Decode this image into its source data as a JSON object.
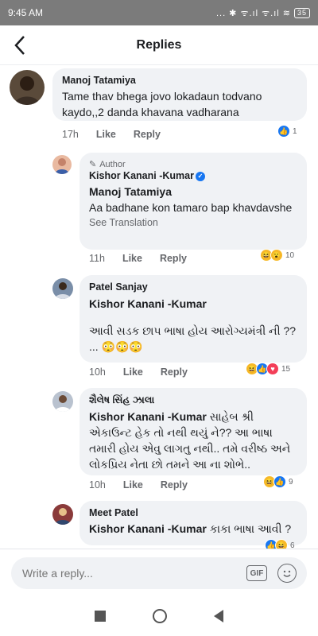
{
  "status_bar": {
    "time": "9:45 AM",
    "indicators": "... ✱ ᯤ.ıl ᯤ.ıl ≋",
    "battery": "35"
  },
  "header": {
    "title": "Replies",
    "back_icon": "back-arrow-icon"
  },
  "comments": [
    {
      "author": "Manoj Tatamiya",
      "text": "Tame thav bhega jovo lokadaun todvano kaydo,,2  danda khavana vadharana",
      "time": "17h",
      "like": "Like",
      "reply": "Reply",
      "reactions": [
        "like"
      ],
      "reaction_count": "1"
    },
    {
      "author_badge": "Author",
      "author": "Kishor Kanani -Kumar",
      "mention": "Manoj Tatamiya",
      "text": "Aa badhane kon tamaro bap khavdavshe",
      "see_translation": "See Translation",
      "time": "11h",
      "like": "Like",
      "reply": "Reply",
      "reactions": [
        "haha",
        "wow"
      ],
      "reaction_count": "10"
    },
    {
      "author": "Patel Sanjay",
      "mention": "Kishor Kanani -Kumar",
      "text": "આવી સડક છાપ ભાષા હોય આરોગ્યમંત્રી ની ?? ... 😳😳😳",
      "time": "10h",
      "like": "Like",
      "reply": "Reply",
      "reactions": [
        "haha",
        "like",
        "love"
      ],
      "reaction_count": "15"
    },
    {
      "author": "શૈલેષ સિંહ ઝાલા",
      "mention": "Kishor Kanani -Kumar",
      "text": "સાહેબ શ્રી એકાઉન્ટ હેક તો નથી થયું ને?? આ ભાષા તમારી હોય એવુ લાગતુ નથી.. તમે વરીષ્ઠ અને લોકપ્રિય નેતા છો તમને આ ના શોભે..",
      "time": "10h",
      "like": "Like",
      "reply": "Reply",
      "reactions": [
        "haha",
        "like"
      ],
      "reaction_count": "9"
    },
    {
      "author": "Meet Patel",
      "mention": "Kishor Kanani -Kumar",
      "text": "કાકા ભાષા આવી ?",
      "reactions": [
        "like",
        "haha"
      ],
      "reaction_count": "6"
    }
  ],
  "composer": {
    "placeholder": "Write a reply...",
    "gif_label": "GIF",
    "emoji_icon": "smiley-icon"
  },
  "colors": {
    "link_blue": "#1877f2",
    "bubble_bg": "#f0f2f5",
    "status_bar_bg": "#7b7b7b"
  }
}
